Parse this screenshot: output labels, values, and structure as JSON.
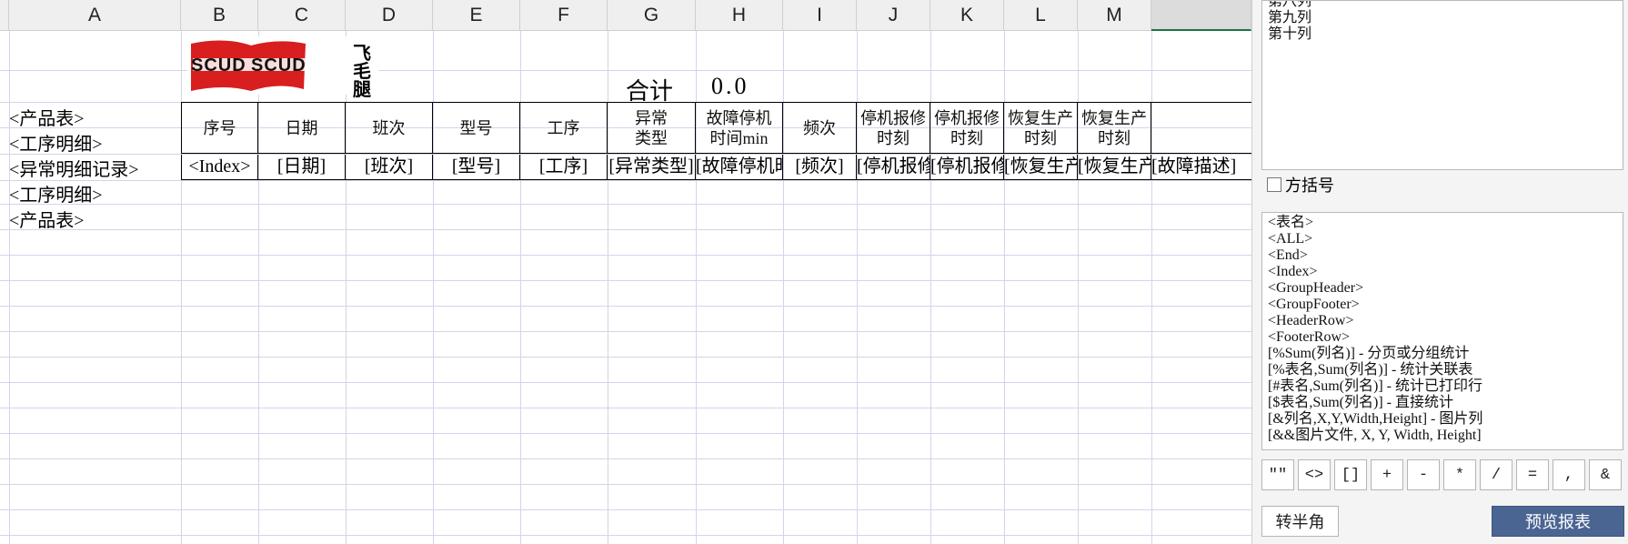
{
  "columns": [
    "A",
    "B",
    "C",
    "D",
    "E",
    "F",
    "G",
    "H",
    "I",
    "J",
    "K",
    "L",
    "M"
  ],
  "logo": {
    "text1": "SCUD",
    "text2": "SCUD",
    "cn1": "飞",
    "cn2": "毛",
    "cn3": "腿"
  },
  "total": {
    "label": "合计",
    "value": "0.0"
  },
  "tags": [
    "<产品表>",
    "<工序明细>",
    "<异常明细记录>",
    "<工序明细>",
    "<产品表>"
  ],
  "header_cells": [
    "序号",
    "日期",
    "班次",
    "型号",
    "工序",
    "异常类型",
    "故障停机时间min",
    "频次",
    "停机报修时刻",
    "停机报修时刻",
    "恢复生产时刻",
    "恢复生产时刻"
  ],
  "placeholders": [
    "<Index>",
    "[日期]",
    "[班次]",
    "[型号]",
    "[工序]",
    "[异常类型]",
    "[故障停机时间]",
    "[频次]",
    "[停机报修时刻]",
    "[停机报修时刻]",
    "[恢复生产时刻]",
    "[恢复生产时刻]",
    "[故障描述]"
  ],
  "panel": {
    "column_list": [
      "第八列",
      "第九列",
      "第十列"
    ],
    "bracket_checkbox_label": "方括号",
    "bracket_checked": false,
    "syntax_list": [
      "<表名>",
      "<ALL>",
      "<End>",
      "<Index>",
      "<GroupHeader>",
      "<GroupFooter>",
      "<HeaderRow>",
      "<FooterRow>",
      "[%Sum(列名)] - 分页或分组统计",
      "[%表名,Sum(列名)] - 统计关联表",
      "[#表名,Sum(列名)] - 统计已打印行",
      "[$表名,Sum(列名)] - 直接统计",
      "[&列名,X,Y,Width,Height] - 图片列",
      "[&&图片文件, X, Y, Width, Height]"
    ],
    "symbols": [
      "\"\"",
      "<>",
      "[]",
      "+",
      "-",
      "*",
      "/",
      "=",
      ",",
      "&"
    ],
    "half_width_button": "转半角",
    "preview_button": "预览报表"
  },
  "colors": {
    "accent_green": "#1e7145",
    "preview_button_bg": "#4a6592",
    "grid_line": "#d4d4ea"
  }
}
